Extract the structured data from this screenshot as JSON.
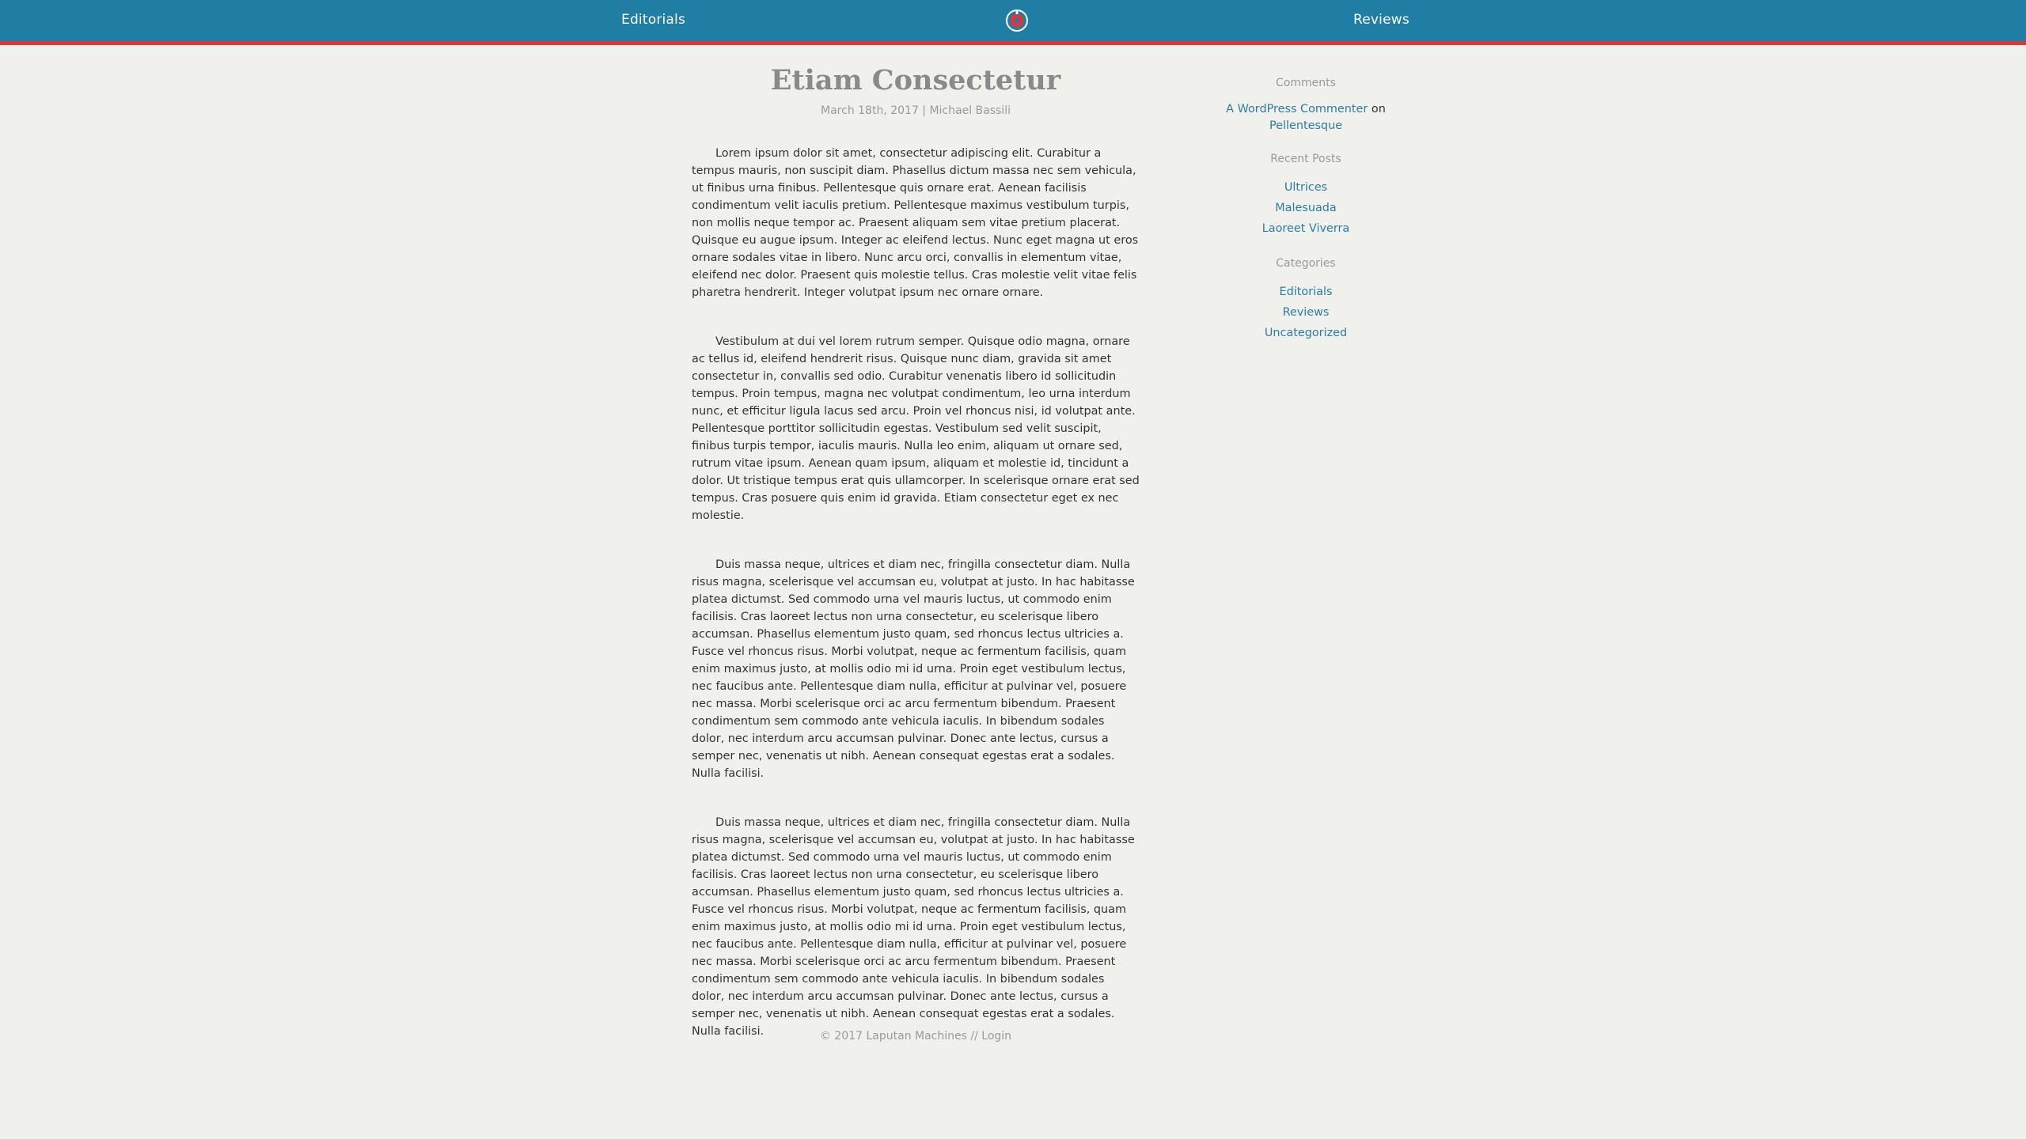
{
  "nav": {
    "left_label": "Editorials",
    "right_label": "Reviews",
    "logo_icon": "gear-logo-icon"
  },
  "post": {
    "title": "Etiam Consectetur",
    "meta": "March 18th, 2017 | Michael Bassili",
    "paragraphs": [
      "Lorem ipsum dolor sit amet, consectetur adipiscing elit. Curabitur a tempus mauris, non suscipit diam. Phasellus dictum massa nec sem vehicula, ut finibus urna finibus. Pellentesque quis ornare erat. Aenean facilisis condimentum velit iaculis pretium. Pellentesque maximus vestibulum turpis, non mollis neque tempor ac. Praesent aliquam sem vitae pretium placerat. Quisque eu augue ipsum. Integer ac eleifend lectus. Nunc eget magna ut eros ornare sodales vitae in libero. Nunc arcu orci, convallis in elementum vitae, eleifend nec dolor. Praesent quis molestie tellus. Cras molestie velit vitae felis pharetra hendrerit. Integer volutpat ipsum nec ornare ornare.",
      "Vestibulum at dui vel lorem rutrum semper. Quisque odio magna, ornare ac tellus id, eleifend hendrerit risus. Quisque nunc diam, gravida sit amet consectetur in, convallis sed odio. Curabitur venenatis libero id sollicitudin tempus. Proin tempus, magna nec volutpat condimentum, leo urna interdum nunc, et efficitur ligula lacus sed arcu. Proin vel rhoncus nisi, id volutpat ante. Pellentesque porttitor sollicitudin egestas. Vestibulum sed velit suscipit, finibus turpis tempor, iaculis mauris. Nulla leo enim, aliquam ut ornare sed, rutrum vitae ipsum. Aenean quam ipsum, aliquam et molestie id, tincidunt a dolor. Ut tristique tempus erat quis ullamcorper. In scelerisque ornare erat sed tempus. Cras posuere quis enim id gravida. Etiam consectetur eget ex nec molestie.",
      "Duis massa neque, ultrices et diam nec, fringilla consectetur diam. Nulla risus magna, scelerisque vel accumsan eu, volutpat at justo. In hac habitasse platea dictumst. Sed commodo urna vel mauris luctus, ut commodo enim facilisis. Cras laoreet lectus non urna consectetur, eu scelerisque libero accumsan. Phasellus elementum justo quam, sed rhoncus lectus ultricies a. Fusce vel rhoncus risus. Morbi volutpat, neque ac fermentum facilisis, quam enim maximus justo, at mollis odio mi id urna. Proin eget vestibulum lectus, nec faucibus ante. Pellentesque diam nulla, efficitur at pulvinar vel, posuere nec massa. Morbi scelerisque orci ac arcu fermentum bibendum. Praesent condimentum sem commodo ante vehicula iaculis. In bibendum sodales dolor, nec interdum arcu accumsan pulvinar. Donec ante lectus, cursus a semper nec, venenatis ut nibh. Aenean consequat egestas erat a sodales. Nulla facilisi.",
      "Duis massa neque, ultrices et diam nec, fringilla consectetur diam. Nulla risus magna, scelerisque vel accumsan eu, volutpat at justo. In hac habitasse platea dictumst. Sed commodo urna vel mauris luctus, ut commodo enim facilisis. Cras laoreet lectus non urna consectetur, eu scelerisque libero accumsan. Phasellus elementum justo quam, sed rhoncus lectus ultricies a. Fusce vel rhoncus risus. Morbi volutpat, neque ac fermentum facilisis, quam enim maximus justo, at mollis odio mi id urna. Proin eget vestibulum lectus, nec faucibus ante. Pellentesque diam nulla, efficitur at pulvinar vel, posuere nec massa. Morbi scelerisque orci ac arcu fermentum bibendum. Praesent condimentum sem commodo ante vehicula iaculis. In bibendum sodales dolor, nec interdum arcu accumsan pulvinar. Donec ante lectus, cursus a semper nec, venenatis ut nibh. Aenean consequat egestas erat a sodales. Nulla facilisi."
    ]
  },
  "sidebar": {
    "comments": {
      "title": "Comments",
      "author": "A WordPress Commenter",
      "on_text": "on",
      "post_link": "Pellentesque"
    },
    "recent_posts": {
      "title": "Recent Posts",
      "items": [
        "Ultrices",
        "Malesuada",
        "Laoreet Viverra"
      ]
    },
    "categories": {
      "title": "Categories",
      "items": [
        "Editorials",
        "Reviews",
        "Uncategorized"
      ]
    }
  },
  "footer": {
    "copyright": "© 2017 Laputan Machines",
    "separator": " // ",
    "login_label": "Login"
  },
  "colors": {
    "header_bg": "#207da3",
    "header_accent": "#e0343f",
    "page_bg": "#f0f0ed",
    "link": "#2f7ca4"
  }
}
